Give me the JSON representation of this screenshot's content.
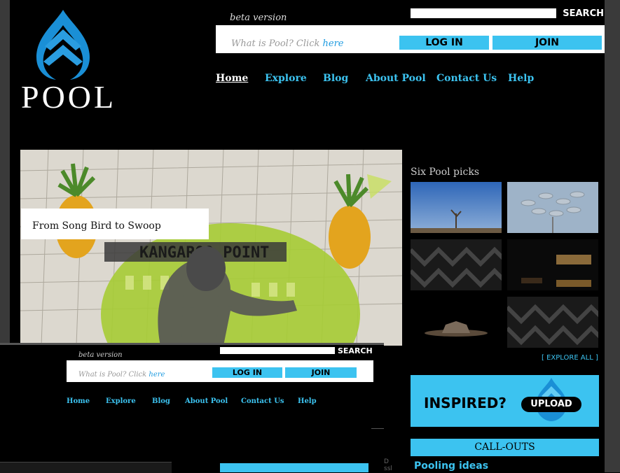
{
  "brand": {
    "name": "POOL",
    "logo_icon": "pool-drop-logo-icon"
  },
  "header": {
    "beta_label": "beta version",
    "search_placeholder": "",
    "search_label": "SEARCH",
    "what_is_pool": "What is Pool? Click ",
    "what_is_pool_link": "here",
    "login_label": "LOG IN",
    "join_label": "JOIN"
  },
  "nav": {
    "items": [
      "Home",
      "Explore",
      "Blog",
      "About Pool",
      "Contact Us",
      "Help"
    ],
    "active": "Home"
  },
  "hero": {
    "caption": "From Song Bird to Swoop",
    "image_text": "KANGAROO POINT"
  },
  "picks": {
    "title": "Six Pool picks",
    "explore_all": "[ EXPLORE ALL ]"
  },
  "inspired": {
    "text": "INSPIRED?",
    "upload_label": "UPLOAD"
  },
  "callouts": {
    "title": "CALL-OUTS",
    "first_item": "Pooling ideas"
  },
  "overlay": {
    "beta_label": "beta version",
    "search_label": "SEARCH",
    "what_is_pool": "What is Pool? Click ",
    "what_is_pool_link": "here",
    "login_label": "LOG IN",
    "join_label": "JOIN",
    "nav": [
      "Home",
      "Explore",
      "Blog",
      "About Pool",
      "Contact Us",
      "Help"
    ],
    "fragment": "D\nssl"
  },
  "colors": {
    "accent": "#3cc3f0",
    "background": "#000000",
    "frame": "#3a3a3a"
  }
}
